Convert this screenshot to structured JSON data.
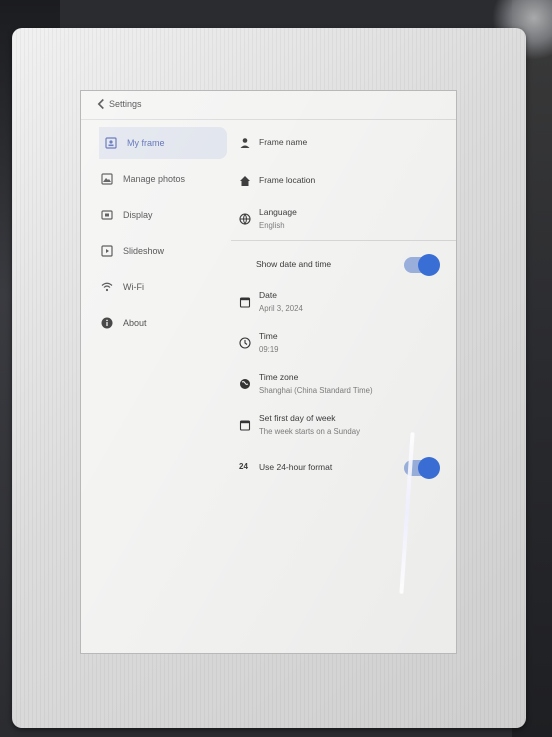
{
  "header": {
    "back_label": "Settings"
  },
  "sidebar": {
    "items": [
      {
        "label": "My frame",
        "icon": "person-badge-icon"
      },
      {
        "label": "Manage photos",
        "icon": "photo-icon"
      },
      {
        "label": "Display",
        "icon": "display-icon"
      },
      {
        "label": "Slideshow",
        "icon": "play-icon"
      },
      {
        "label": "Wi-Fi",
        "icon": "wifi-icon"
      },
      {
        "label": "About",
        "icon": "info-icon"
      }
    ]
  },
  "settings": {
    "frame_name": {
      "label": "Frame name",
      "icon": "person-icon"
    },
    "frame_location": {
      "label": "Frame location",
      "icon": "home-icon"
    },
    "language": {
      "label": "Language",
      "value": "English",
      "icon": "globe-icon"
    },
    "show_date_time": {
      "label": "Show date and time",
      "enabled": true
    },
    "date": {
      "label": "Date",
      "value": "April 3, 2024",
      "icon": "calendar-icon"
    },
    "time": {
      "label": "Time",
      "value": "09:19",
      "icon": "clock-icon"
    },
    "time_zone": {
      "label": "Time zone",
      "value": "Shanghai (China Standard Time)",
      "icon": "globe-icon"
    },
    "first_day": {
      "label": "Set first day of week",
      "value": "The week starts on a Sunday",
      "icon": "calendar-icon"
    },
    "format_24h": {
      "label": "Use 24-hour format",
      "icon_text": "24",
      "enabled": true
    }
  },
  "colors": {
    "accent": "#3a6fd8",
    "active_bg": "#dfe3ec"
  }
}
